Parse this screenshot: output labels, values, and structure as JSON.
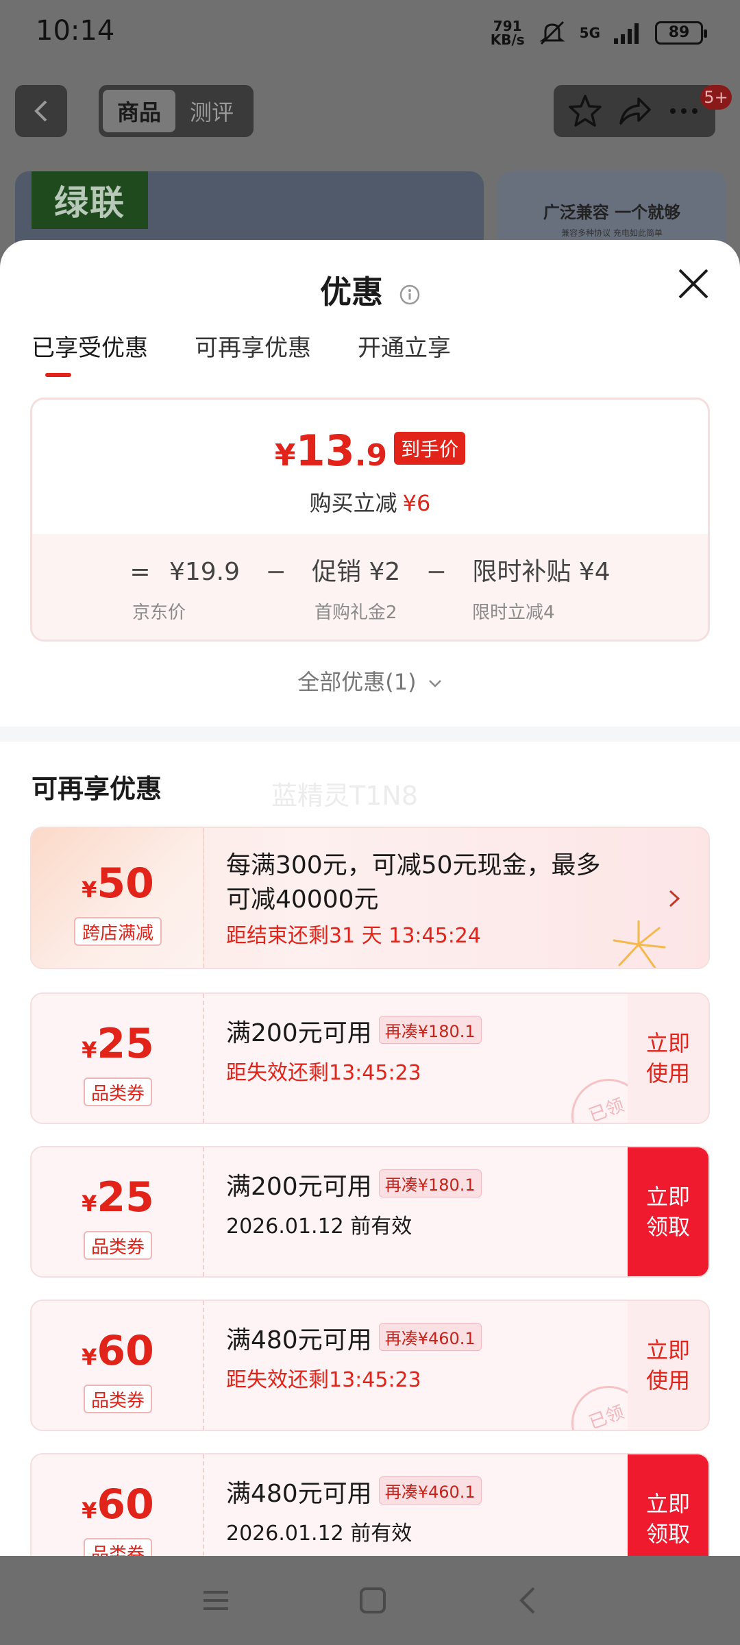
{
  "status_bar": {
    "time": "10:14",
    "net_speed_value": "791",
    "net_speed_unit": "KB/s",
    "network": "5G",
    "battery": "89"
  },
  "top_nav": {
    "tabs": [
      "商品",
      "测评"
    ],
    "badge": "5+"
  },
  "background": {
    "brand": "绿联",
    "right_card_title": "广泛兼容 一个就够",
    "right_card_sub": "兼容多种协议 充电如此简单"
  },
  "sheet": {
    "title": "优惠",
    "tabs": [
      "已享受优惠",
      "可再享优惠",
      "开通立享"
    ],
    "summary": {
      "currency": "¥",
      "price_int": "13",
      "price_dec": ".9",
      "price_tag": "到手价",
      "reduce_label": "购买立减",
      "reduce_amount": "¥6",
      "formula": {
        "eq": "=",
        "jd_price": "¥19.9",
        "minus": "−",
        "promo": "促销 ¥2",
        "subsidy": "限时补贴 ¥4",
        "jd_price_label": "京东价",
        "promo_label": "首购礼金2",
        "subsidy_label": "限时立减4"
      }
    },
    "all_offers": "全部优惠(1)",
    "section_title": "可再享优惠",
    "watermark": "蓝精灵T1N8",
    "coupons": [
      {
        "yen": "¥",
        "amount": "50",
        "type": "跨店满减",
        "cond_line1": "每满300元，可减50元现金，最多",
        "cond_line2": "可减40000元",
        "sub": "距结束还剩31 天 13:45:24"
      },
      {
        "yen": "¥",
        "amount": "25",
        "type": "品类券",
        "cond": "满200元可用",
        "gap": "再凑¥180.1",
        "sub": "距失效还剩13:45:23",
        "action_l1": "立即",
        "action_l2": "使用",
        "stamp": "已领"
      },
      {
        "yen": "¥",
        "amount": "25",
        "type": "品类券",
        "cond": "满200元可用",
        "gap": "再凑¥180.1",
        "sub": "2026.01.12 前有效",
        "action_l1": "立即",
        "action_l2": "领取"
      },
      {
        "yen": "¥",
        "amount": "60",
        "type": "品类券",
        "cond": "满480元可用",
        "gap": "再凑¥460.1",
        "sub": "距失效还剩13:45:23",
        "action_l1": "立即",
        "action_l2": "使用",
        "stamp": "已领"
      },
      {
        "yen": "¥",
        "amount": "60",
        "type": "品类券",
        "cond": "满480元可用",
        "gap": "再凑¥460.1",
        "sub": "2026.01.12 前有效",
        "action_l1": "立即",
        "action_l2": "领取"
      }
    ]
  },
  "colors": {
    "accent": "#e2231a",
    "action_red": "#f01a2e"
  }
}
